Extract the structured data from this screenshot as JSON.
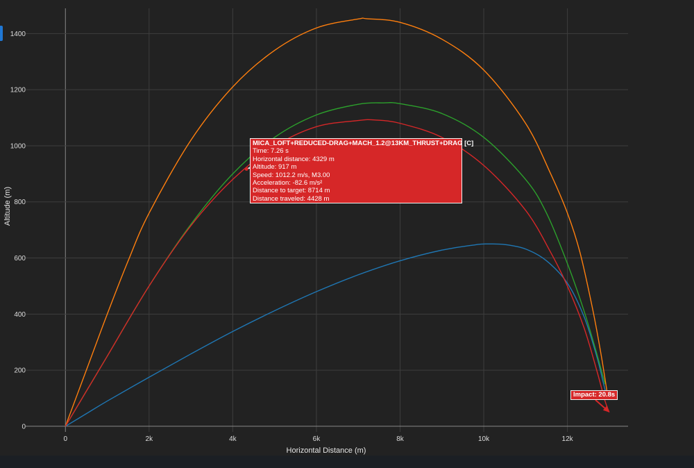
{
  "chart_data": {
    "type": "line",
    "title": "",
    "xlabel": "Horizontal Distance (m)",
    "ylabel": "Altitude (m)",
    "xlim": [
      -950,
      13450
    ],
    "ylim": [
      -20,
      1490
    ],
    "x_ticks": [
      0,
      2000,
      4000,
      6000,
      8000,
      10000,
      12000
    ],
    "x_tick_labels": [
      "0",
      "2k",
      "4k",
      "6k",
      "8k",
      "10k",
      "12k"
    ],
    "y_ticks": [
      0,
      200,
      400,
      600,
      800,
      1000,
      1200,
      1400
    ],
    "y_tick_labels": [
      "0",
      "200",
      "400",
      "600",
      "800",
      "1000",
      "1200",
      "1400"
    ],
    "grid": true,
    "series": [
      {
        "color": "#1f77b4",
        "points": [
          [
            0,
            0
          ],
          [
            500,
            45
          ],
          [
            1000,
            90
          ],
          [
            2000,
            175
          ],
          [
            3000,
            258
          ],
          [
            4000,
            338
          ],
          [
            5000,
            412
          ],
          [
            6000,
            480
          ],
          [
            7000,
            540
          ],
          [
            8000,
            590
          ],
          [
            9000,
            628
          ],
          [
            9800,
            647
          ],
          [
            10100,
            650
          ],
          [
            10500,
            648
          ],
          [
            11000,
            632
          ],
          [
            11500,
            590
          ],
          [
            12000,
            510
          ],
          [
            12400,
            390
          ],
          [
            12700,
            250
          ],
          [
            12850,
            160
          ],
          [
            12950,
            100
          ]
        ]
      },
      {
        "color": "#ff7f0e",
        "points": [
          [
            0,
            0
          ],
          [
            300,
            120
          ],
          [
            600,
            240
          ],
          [
            1000,
            400
          ],
          [
            1500,
            590
          ],
          [
            2000,
            760
          ],
          [
            3000,
            1020
          ],
          [
            4000,
            1210
          ],
          [
            5000,
            1340
          ],
          [
            6000,
            1420
          ],
          [
            7000,
            1452
          ],
          [
            7200,
            1453
          ],
          [
            8000,
            1440
          ],
          [
            9000,
            1380
          ],
          [
            10000,
            1270
          ],
          [
            11000,
            1080
          ],
          [
            11600,
            900
          ],
          [
            12000,
            760
          ],
          [
            12300,
            620
          ],
          [
            12600,
            420
          ],
          [
            12800,
            260
          ],
          [
            12950,
            120
          ]
        ]
      },
      {
        "color": "#2ca02c",
        "points": [
          [
            0,
            0
          ],
          [
            500,
            125
          ],
          [
            1000,
            250
          ],
          [
            2000,
            500
          ],
          [
            3000,
            720
          ],
          [
            4000,
            900
          ],
          [
            5000,
            1030
          ],
          [
            6000,
            1110
          ],
          [
            7000,
            1148
          ],
          [
            7600,
            1153
          ],
          [
            8000,
            1150
          ],
          [
            9000,
            1115
          ],
          [
            10000,
            1030
          ],
          [
            11000,
            880
          ],
          [
            11500,
            760
          ],
          [
            12000,
            580
          ],
          [
            12400,
            410
          ],
          [
            12700,
            260
          ],
          [
            12900,
            150
          ]
        ]
      },
      {
        "color": "#d62728",
        "points": [
          [
            0,
            0
          ],
          [
            500,
            125
          ],
          [
            1000,
            250
          ],
          [
            2000,
            500
          ],
          [
            3000,
            715
          ],
          [
            4000,
            880
          ],
          [
            5000,
            998
          ],
          [
            6000,
            1068
          ],
          [
            7000,
            1090
          ],
          [
            7400,
            1092
          ],
          [
            8000,
            1080
          ],
          [
            9000,
            1030
          ],
          [
            10000,
            930
          ],
          [
            11000,
            770
          ],
          [
            11600,
            620
          ],
          [
            12000,
            500
          ],
          [
            12400,
            350
          ],
          [
            12700,
            200
          ],
          [
            12900,
            90
          ],
          [
            13000,
            50
          ]
        ]
      }
    ],
    "hover": {
      "title": "MICA_LOFT+REDUCED-DRAG+MACH_1.2@13KM_THRUST+DRAG [C]",
      "rows": [
        "Time: 7.26 s",
        "Horizontal distance: 4329 m",
        "Altitude: 917 m",
        "Speed: 1012.2 m/s, M3.00",
        "Acceleration: -82.6 m/s²",
        "Distance to target: 8714 m",
        "Distance traveled: 4428 m"
      ],
      "point": [
        4329,
        917
      ],
      "color": "#d62728"
    },
    "annotation": {
      "text": "Impact: 20.8s",
      "point": [
        13000,
        50
      ],
      "color": "#d62728"
    }
  }
}
